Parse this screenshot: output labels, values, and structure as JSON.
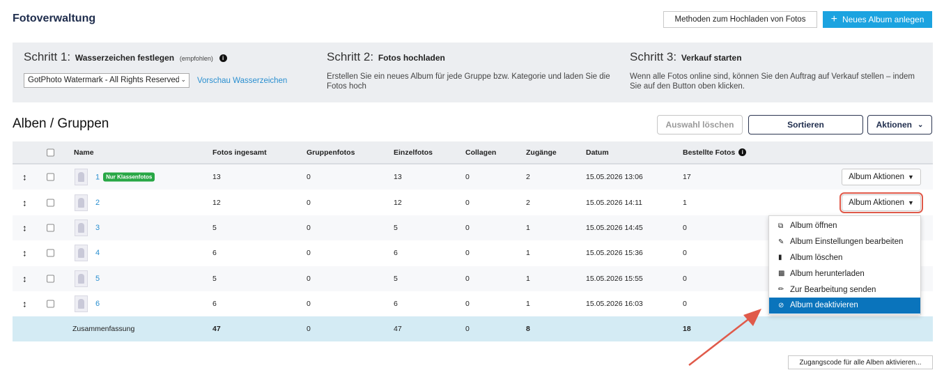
{
  "header": {
    "title": "Fotoverwaltung",
    "upload_methods_label": "Methoden zum Hochladen von Fotos",
    "new_album_label": "Neues Album anlegen",
    "new_album_icon": "plus-icon"
  },
  "steps": [
    {
      "prefix": "Schritt 1:",
      "title": "Wasserzeichen festlegen",
      "note": "(empfohlen)",
      "watermark_selected": "GotPhoto Watermark - All Rights Reserved",
      "preview_link": "Vorschau Wasserzeichen"
    },
    {
      "prefix": "Schritt 2:",
      "title": "Fotos hochladen",
      "text": "Erstellen Sie ein neues Album für jede Gruppe bzw. Kategorie und laden Sie die Fotos hoch"
    },
    {
      "prefix": "Schritt 3:",
      "title": "Verkauf starten",
      "text": "Wenn alle Fotos online sind, können Sie den Auftrag auf Verkauf stellen – indem Sie auf den Button oben klicken."
    }
  ],
  "albums_section": {
    "title": "Alben / Gruppen",
    "clear_selection_label": "Auswahl löschen",
    "sort_label": "Sortieren",
    "actions_label": "Aktionen"
  },
  "table": {
    "columns": [
      "Name",
      "Fotos ingesamt",
      "Gruppenfotos",
      "Einzelfotos",
      "Collagen",
      "Zugänge",
      "Datum",
      "Bestellte Fotos"
    ],
    "rows": [
      {
        "name": "1",
        "badge": "Nur Klassenfotos",
        "total": "13",
        "group": "0",
        "single": "13",
        "collages": "0",
        "access": "2",
        "date": "15.05.2026 13:06",
        "ordered": "17",
        "action_label": "Album Aktionen"
      },
      {
        "name": "2",
        "total": "12",
        "group": "0",
        "single": "12",
        "collages": "0",
        "access": "2",
        "date": "15.05.2026 14:11",
        "ordered": "1",
        "action_label": "Album Aktionen"
      },
      {
        "name": "3",
        "total": "5",
        "group": "0",
        "single": "5",
        "collages": "0",
        "access": "1",
        "date": "15.05.2026 14:45",
        "ordered": "0"
      },
      {
        "name": "4",
        "total": "6",
        "group": "0",
        "single": "6",
        "collages": "0",
        "access": "1",
        "date": "15.05.2026 15:36",
        "ordered": "0"
      },
      {
        "name": "5",
        "total": "5",
        "group": "0",
        "single": "5",
        "collages": "0",
        "access": "1",
        "date": "15.05.2026 15:55",
        "ordered": "0"
      },
      {
        "name": "6",
        "total": "6",
        "group": "0",
        "single": "6",
        "collages": "0",
        "access": "1",
        "date": "15.05.2026 16:03",
        "ordered": "0"
      }
    ],
    "summary": {
      "label": "Zusammenfassung",
      "total": "47",
      "group": "0",
      "single": "47",
      "collages": "0",
      "access": "8",
      "ordered": "18"
    }
  },
  "album_menu": {
    "items": [
      {
        "label": "Album öffnen",
        "icon": "external-link-icon"
      },
      {
        "label": "Album Einstellungen bearbeiten",
        "icon": "pencil-icon"
      },
      {
        "label": "Album löschen",
        "icon": "trash-icon"
      },
      {
        "label": "Album herunterladen",
        "icon": "file-download-icon"
      },
      {
        "label": "Zur Bearbeitung senden",
        "icon": "edit-square-icon"
      },
      {
        "label": "Album deaktivieren",
        "icon": "ban-icon",
        "active": true
      }
    ]
  },
  "footer": {
    "access_code_label": "Zugangscode für alle Alben aktivieren..."
  },
  "colors": {
    "accent": "#1ba3e0",
    "menu_active": "#0a74bc",
    "badge": "#28a745",
    "annotation": "#e05a4a",
    "summary_bg": "#d4ebf4"
  }
}
